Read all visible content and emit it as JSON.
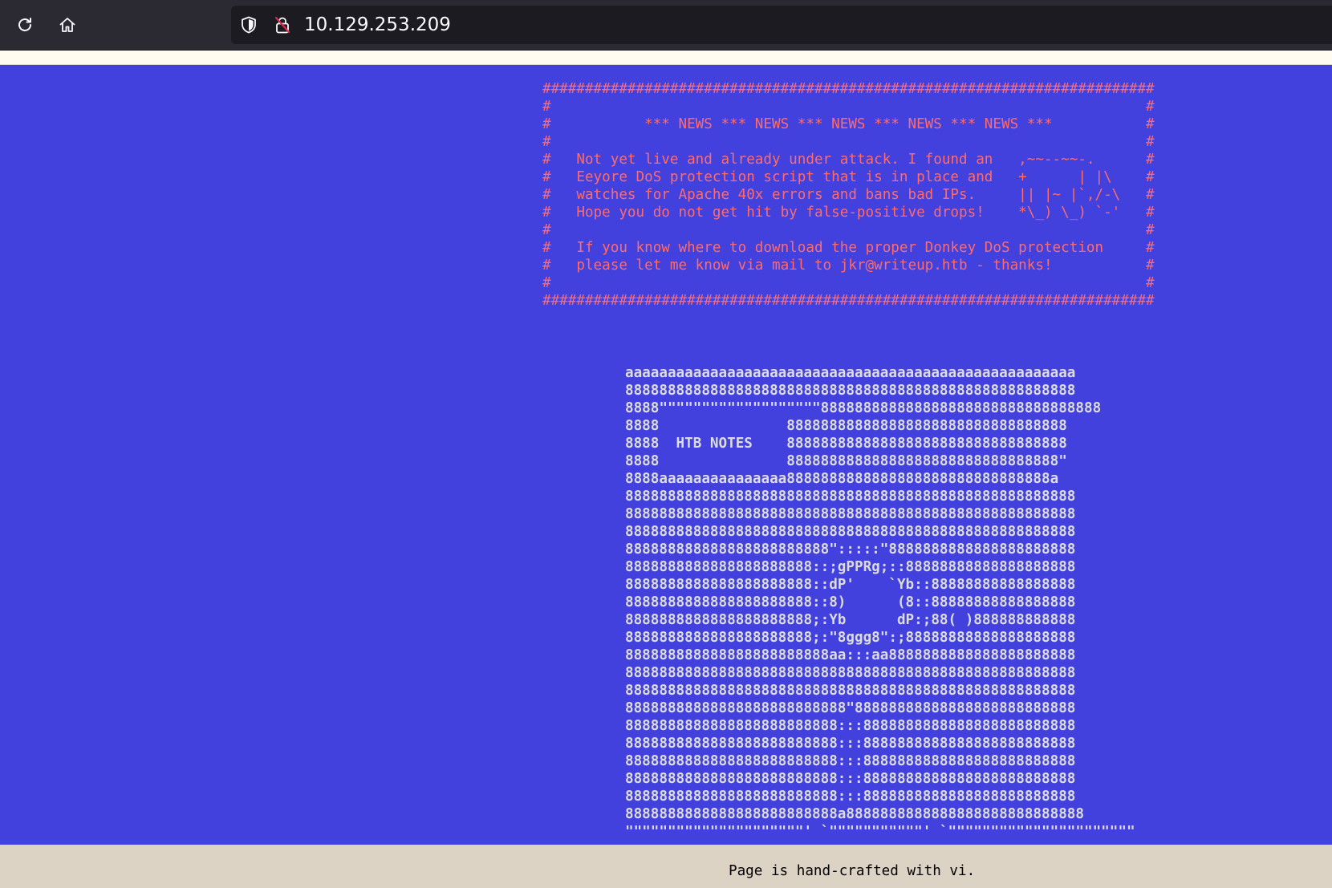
{
  "browser": {
    "url": "10.129.253.209",
    "reload_icon": "reload-icon",
    "home_icon": "home-icon",
    "shield_icon": "shield-icon",
    "insecure_lock_icon": "insecure-lock-icon"
  },
  "page": {
    "background_color": "#4241dd",
    "news_color": "#ff6b6b",
    "art_color": "#dcdcdc",
    "news_box": "########################################################################\n#                                                                      #\n#           *** NEWS *** NEWS *** NEWS *** NEWS *** NEWS ***           #\n#                                                                      #\n#   Not yet live and already under attack. I found an   ,~~--~~-.      #\n#   Eeyore DoS protection script that is in place and   +      | |\\    #\n#   watches for Apache 40x errors and bans bad IPs.     || |~ |`,/-\\   #\n#   Hope you do not get hit by false-positive drops!    *\\_) \\_) `-'   #\n#                                                                      #\n#   If you know where to download the proper Donkey DoS protection     #\n#   please let me know via mail to jkr@writeup.htb - thanks!           #\n#                                                                      #\n########################################################################",
    "ascii_art": "aaaaaaaaaaaaaaaaaaaaaaaaaaaaaaaaaaaaaaaaaaaaaaaaaaaaa\n88888888888888888888888888888888888888888888888888888\n8888\"\"\"\"\"\"\"\"\"\"\"\"\"\"\"\"\"\"\"888888888888888888888888888888888\n8888               888888888888888888888888888888888\n8888  HTB NOTES    888888888888888888888888888888888\n8888               88888888888888888888888888888888\"\n8888aaaaaaaaaaaaaaa8888888888888888888888888888888a\n88888888888888888888888888888888888888888888888888888\n88888888888888888888888888888888888888888888888888888\n88888888888888888888888888888888888888888888888888888\n888888888888888888888888\":::::\"8888888888888888888888\n8888888888888888888888::;gPPRg;::88888888888888888888\n8888888888888888888888::dP'    `Yb::88888888888888888\n8888888888888888888888::8)      (8::88888888888888888\n8888888888888888888888;:Yb      dP:;88( )888888888888\n8888888888888888888888;:\"8ggg8\":;88888888888888888888\n888888888888888888888888aa:::aa8888888888888888888888\n88888888888888888888888888888888888888888888888888888\n88888888888888888888888888888888888888888888888888888\n88888888888888888888888888\"88888888888888888888888888\n8888888888888888888888888:::8888888888888888888888888\n8888888888888888888888888:::8888888888888888888888888\n8888888888888888888888888:::8888888888888888888888888\n8888888888888888888888888:::8888888888888888888888888\n8888888888888888888888888:::8888888888888888888888888\n8888888888888888888888888a8888888888888888888888888888\n\"\"\"\"\"\"\"\"\"\"\"\"\"\"\"\"\"\"\"\"\"' `\"\"\"\"\"\"\"\"\"\"\"' `\"\"\"\"\"\"\"\"\"\"\"\"\"\"\"\"\"\"\"\"\"\"",
    "footer": "Page is hand-crafted with vi."
  }
}
